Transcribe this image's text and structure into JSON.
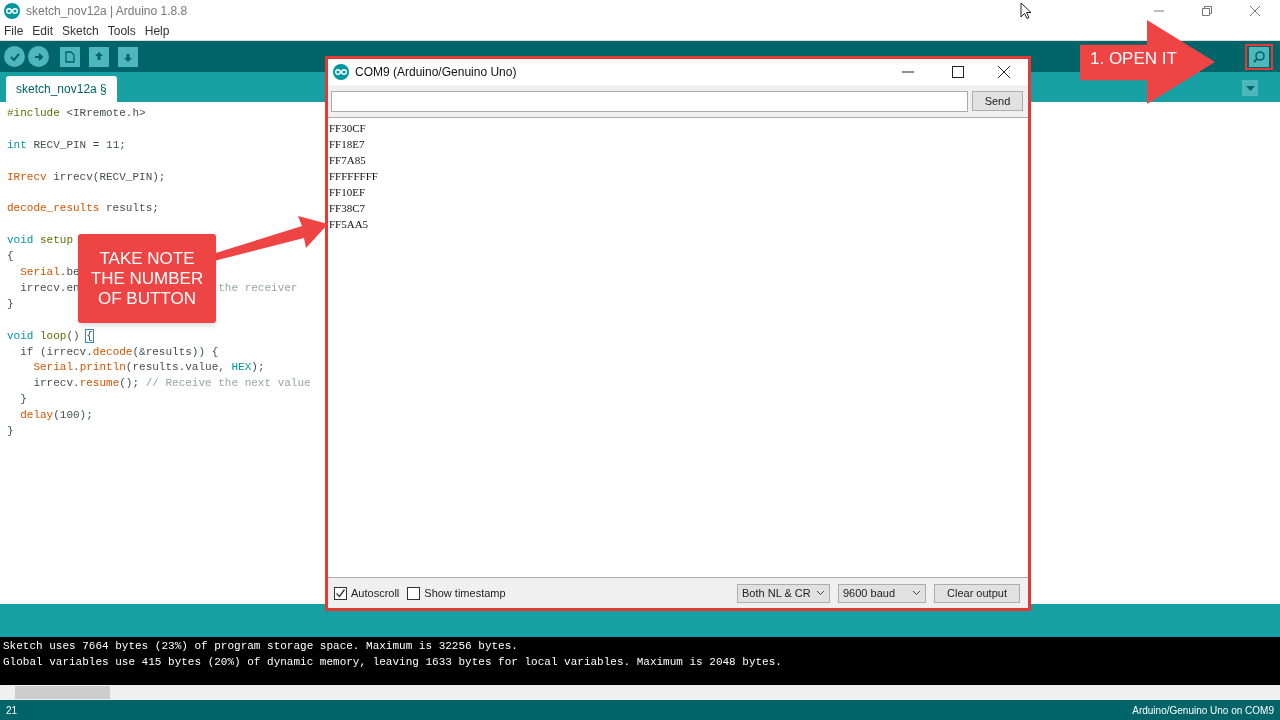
{
  "window": {
    "title": "sketch_nov12a | Arduino 1.8.8"
  },
  "menu": [
    "File",
    "Edit",
    "Sketch",
    "Tools",
    "Help"
  ],
  "tabs": [
    {
      "label": "sketch_nov12a §",
      "selected": true
    }
  ],
  "code": [
    {
      "kind": "code",
      "tokens": [
        {
          "kind": "preproc",
          "text": "#include"
        },
        {
          "kind": "plain",
          "text": " <IRremote.h>"
        }
      ]
    },
    {
      "kind": "blank"
    },
    {
      "kind": "code",
      "tokens": [
        {
          "kind": "keyword",
          "text": "int"
        },
        {
          "kind": "plain",
          "text": " RECV_PIN = 11;"
        }
      ]
    },
    {
      "kind": "blank"
    },
    {
      "kind": "code",
      "tokens": [
        {
          "kind": "func",
          "text": "IRrecv"
        },
        {
          "kind": "plain",
          "text": " irrecv(RECV_PIN);"
        }
      ]
    },
    {
      "kind": "blank"
    },
    {
      "kind": "code",
      "tokens": [
        {
          "kind": "func",
          "text": "decode_results"
        },
        {
          "kind": "plain",
          "text": " results;"
        }
      ]
    },
    {
      "kind": "blank"
    },
    {
      "kind": "code",
      "tokens": [
        {
          "kind": "keyword",
          "text": "void "
        },
        {
          "kind": "name",
          "text": "setup"
        }
      ]
    },
    {
      "kind": "code",
      "tokens": [
        {
          "kind": "plain",
          "text": "{"
        }
      ]
    },
    {
      "kind": "code",
      "tokens": [
        {
          "kind": "func",
          "text": "  Serial"
        },
        {
          "kind": "plain",
          "text": ".be"
        }
      ]
    },
    {
      "kind": "code",
      "tokens": [
        {
          "kind": "plain",
          "text": "  irrecv.en"
        },
        {
          "kind": "covered"
        },
        {
          "kind": "comment",
          "text": "the receiver"
        }
      ]
    },
    {
      "kind": "code",
      "tokens": [
        {
          "kind": "plain",
          "text": "}"
        }
      ]
    },
    {
      "kind": "blank"
    },
    {
      "kind": "code",
      "tokens": [
        {
          "kind": "keyword",
          "text": "void "
        },
        {
          "kind": "name",
          "text": "loop"
        },
        {
          "kind": "plain",
          "text": "() "
        },
        {
          "kind": "bracket",
          "text": "{"
        }
      ]
    },
    {
      "kind": "code",
      "tokens": [
        {
          "kind": "plain",
          "text": "  if (irrecv."
        },
        {
          "kind": "func",
          "text": "decode"
        },
        {
          "kind": "plain",
          "text": "(&results)) {"
        }
      ]
    },
    {
      "kind": "code",
      "tokens": [
        {
          "kind": "func",
          "text": "    Serial"
        },
        {
          "kind": "plain",
          "text": "."
        },
        {
          "kind": "func",
          "text": "println"
        },
        {
          "kind": "plain",
          "text": "(results.value, "
        },
        {
          "kind": "keyword",
          "text": "HEX"
        },
        {
          "kind": "plain",
          "text": ");"
        }
      ]
    },
    {
      "kind": "code",
      "tokens": [
        {
          "kind": "plain",
          "text": "    irrecv."
        },
        {
          "kind": "func",
          "text": "resume"
        },
        {
          "kind": "plain",
          "text": "(); "
        },
        {
          "kind": "comment",
          "text": "// Receive the next value"
        }
      ]
    },
    {
      "kind": "code",
      "tokens": [
        {
          "kind": "plain",
          "text": "  }"
        }
      ]
    },
    {
      "kind": "code",
      "tokens": [
        {
          "kind": "func",
          "text": "  delay"
        },
        {
          "kind": "plain",
          "text": "(100);"
        }
      ]
    },
    {
      "kind": "code",
      "tokens": [
        {
          "kind": "plain",
          "text": "}"
        }
      ]
    }
  ],
  "console": [
    "Sketch uses 7664 bytes (23%) of program storage space. Maximum is 32256 bytes.",
    "Global variables use 415 bytes (20%) of dynamic memory, leaving 1633 bytes for local variables. Maximum is 2048 bytes."
  ],
  "status_bar": {
    "line": "21",
    "board": "Arduino/Genuino Uno on COM9"
  },
  "serial_monitor": {
    "title": "COM9 (Arduino/Genuino Uno)",
    "send": "Send",
    "output": [
      "FF30CF",
      "FF18E7",
      "FF7A85",
      "FFFFFFFF",
      "FF10EF",
      "FF38C7",
      "FF5AA5"
    ],
    "autoscroll": {
      "label": "Autoscroll",
      "checked": true
    },
    "timestamp": {
      "label": "Show timestamp",
      "checked": false
    },
    "line_ending": "Both NL & CR",
    "baud": "9600 baud",
    "clear": "Clear output"
  },
  "callouts": [
    {
      "text": "TAKE NOTE THE NUMBER OF BUTTON"
    },
    {
      "text": "1. OPEN IT"
    }
  ]
}
